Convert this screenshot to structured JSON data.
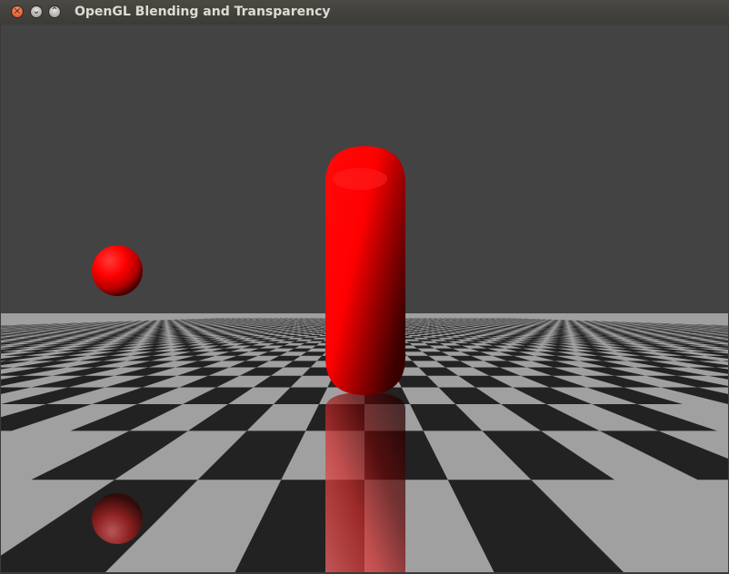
{
  "window": {
    "title": "OpenGL Blending and Transparency",
    "controls": {
      "close": "×",
      "minimize": "⌄",
      "maximize": "⌃"
    }
  },
  "scene": {
    "background_color": "#434343",
    "floor": {
      "light_color": "#a0a0a0",
      "dark_color": "#222222"
    },
    "object_color": "#ff0000",
    "objects": [
      "sphere",
      "capsule"
    ],
    "reflections": [
      "sphere-reflection",
      "capsule-reflection"
    ]
  }
}
